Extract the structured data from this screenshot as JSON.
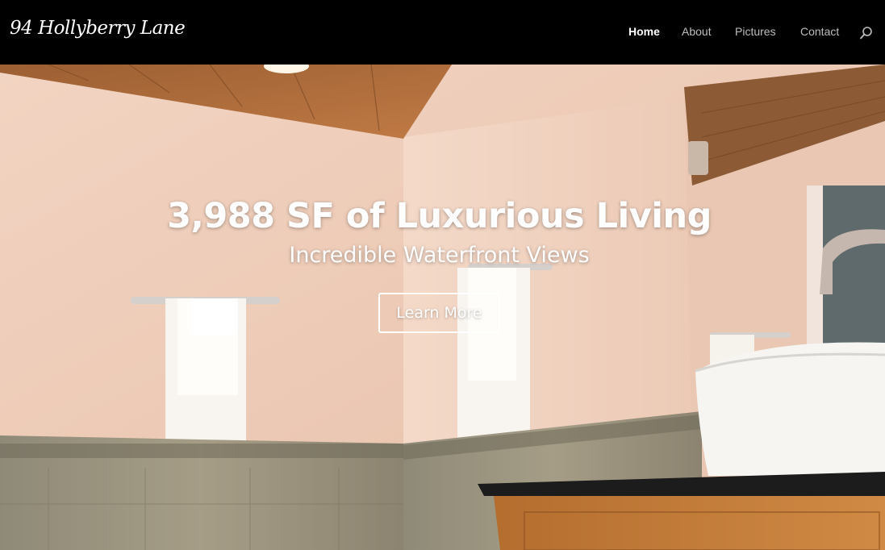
{
  "site": {
    "logo_text": "94 Hollyberry Lane"
  },
  "nav": {
    "items": [
      {
        "label": "Home",
        "active": true
      },
      {
        "label": "About",
        "active": false
      },
      {
        "label": "Pictures",
        "active": false
      },
      {
        "label": "Contact",
        "active": false
      }
    ],
    "search_icon": "search-icon"
  },
  "hero": {
    "title": "3,988 SF of Luxurious Living",
    "subtitle": "Incredible Waterfront Views",
    "button_label": "Learn More",
    "background": "bathroom-photo"
  },
  "colors": {
    "header_bg": "#000000",
    "nav_active": "#ffffff",
    "nav_inactive": "#bdbdbd",
    "hero_text": "#ffffff"
  }
}
